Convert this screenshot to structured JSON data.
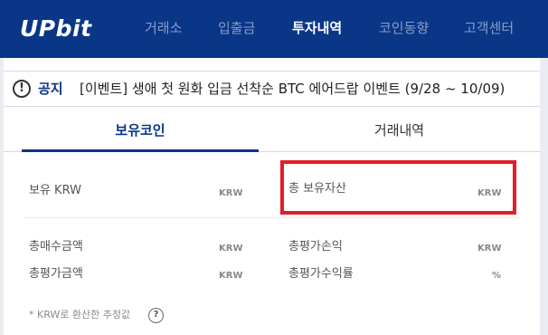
{
  "header": {
    "logo": "UPbit",
    "nav": [
      "거래소",
      "입출금",
      "투자내역",
      "코인동향",
      "고객센터"
    ],
    "active_nav": "투자내역"
  },
  "notice": {
    "icon": "exclamation-icon",
    "label": "공지",
    "text": "[이벤트] 생애 첫 원화 입금 선착순 BTC 에어드랍 이벤트 (9/28 ~ 10/09)"
  },
  "tabs": [
    "보유코인",
    "거래내역"
  ],
  "active_tab": "보유코인",
  "summary": {
    "holding_krw": {
      "label": "보유 KRW",
      "unit": "KRW"
    },
    "total_assets": {
      "label": "총 보유자산",
      "unit": "KRW"
    },
    "total_buy": {
      "label": "총매수금액",
      "unit": "KRW"
    },
    "total_pnl": {
      "label": "총평가손익",
      "unit": "KRW"
    },
    "total_eval": {
      "label": "총평가금액",
      "unit": "KRW"
    },
    "return_rate": {
      "label": "총평가수익률",
      "unit": "%"
    }
  },
  "footnote": "* KRW로 환산한 추정값",
  "help_icon_text": "?",
  "colors": {
    "brand": "#093687",
    "highlight": "#e21f26"
  }
}
